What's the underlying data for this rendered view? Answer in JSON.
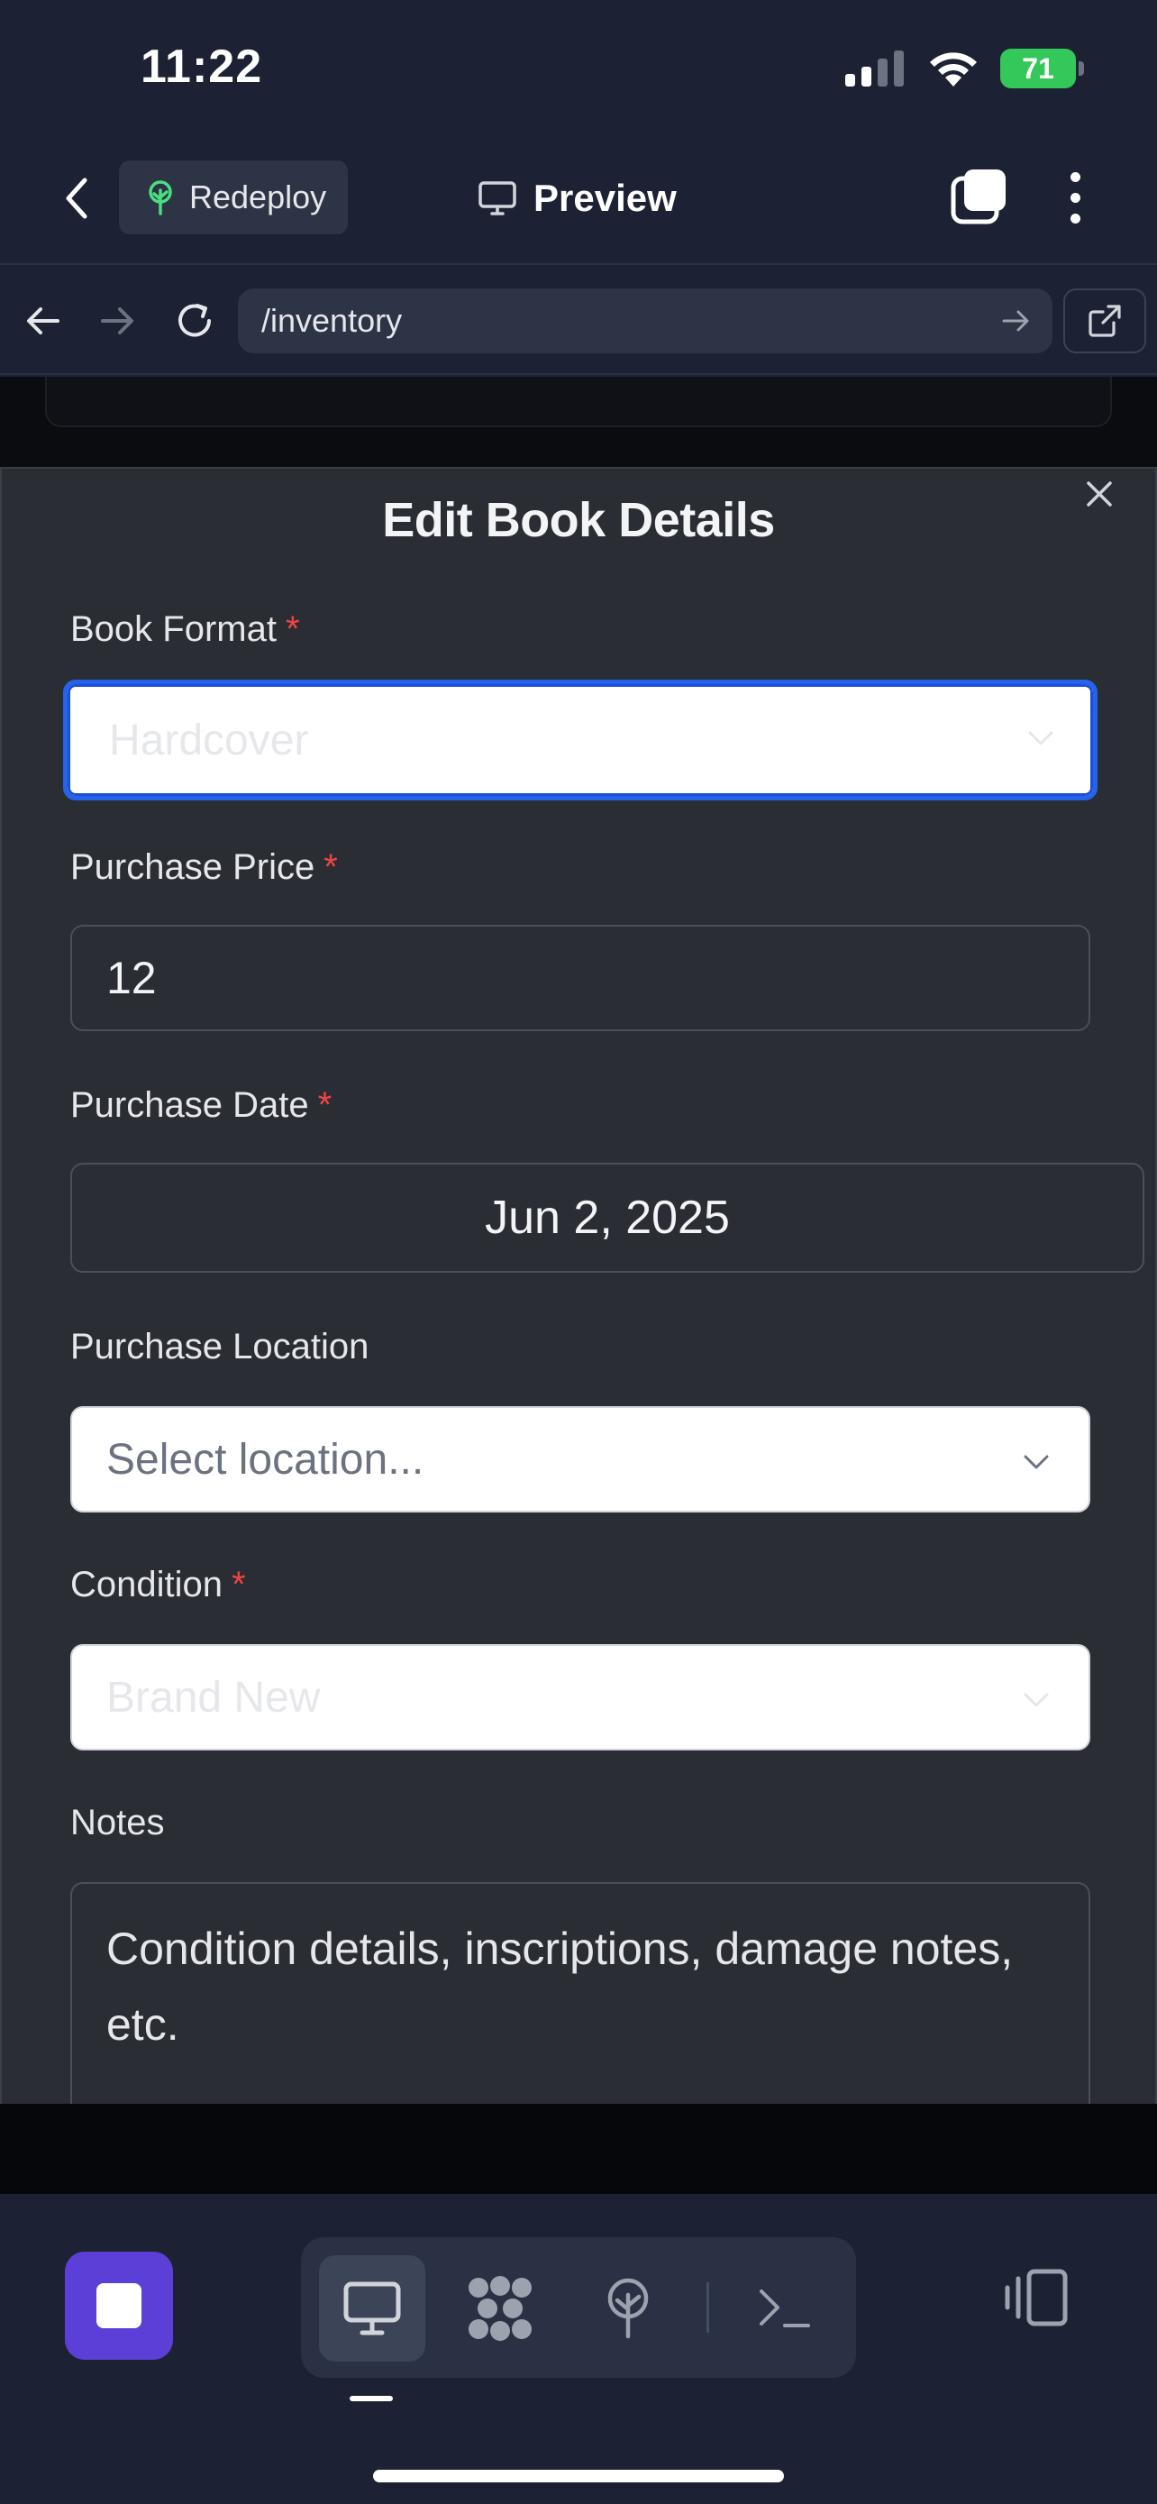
{
  "status_bar": {
    "time": "11:22",
    "battery": "71"
  },
  "header": {
    "redeploy_label": "Redeploy",
    "preview_label": "Preview"
  },
  "browser": {
    "url": "/inventory"
  },
  "modal": {
    "title": "Edit Book Details",
    "required_marker": "*",
    "book_format": {
      "label": "Book Format",
      "value": "Hardcover"
    },
    "purchase_price": {
      "label": "Purchase Price",
      "value": "12"
    },
    "purchase_date": {
      "label": "Purchase Date",
      "value": "Jun 2, 2025"
    },
    "purchase_location": {
      "label": "Purchase Location",
      "placeholder": "Select location..."
    },
    "condition": {
      "label": "Condition",
      "value": "Brand New"
    },
    "notes": {
      "label": "Notes",
      "placeholder": "Condition details, inscriptions, damage notes, etc."
    }
  },
  "colors": {
    "accent": "#5b3fd6",
    "focus": "#2563eb",
    "required": "#ef4444",
    "battery": "#34c759",
    "redeploy_icon": "#4ade80"
  },
  "icons": {
    "back": "chevron-left-icon",
    "redeploy": "tree-icon",
    "preview": "monitor-icon",
    "close": "close-icon",
    "select": "chevron-down-icon",
    "terminal": "terminal-icon"
  }
}
